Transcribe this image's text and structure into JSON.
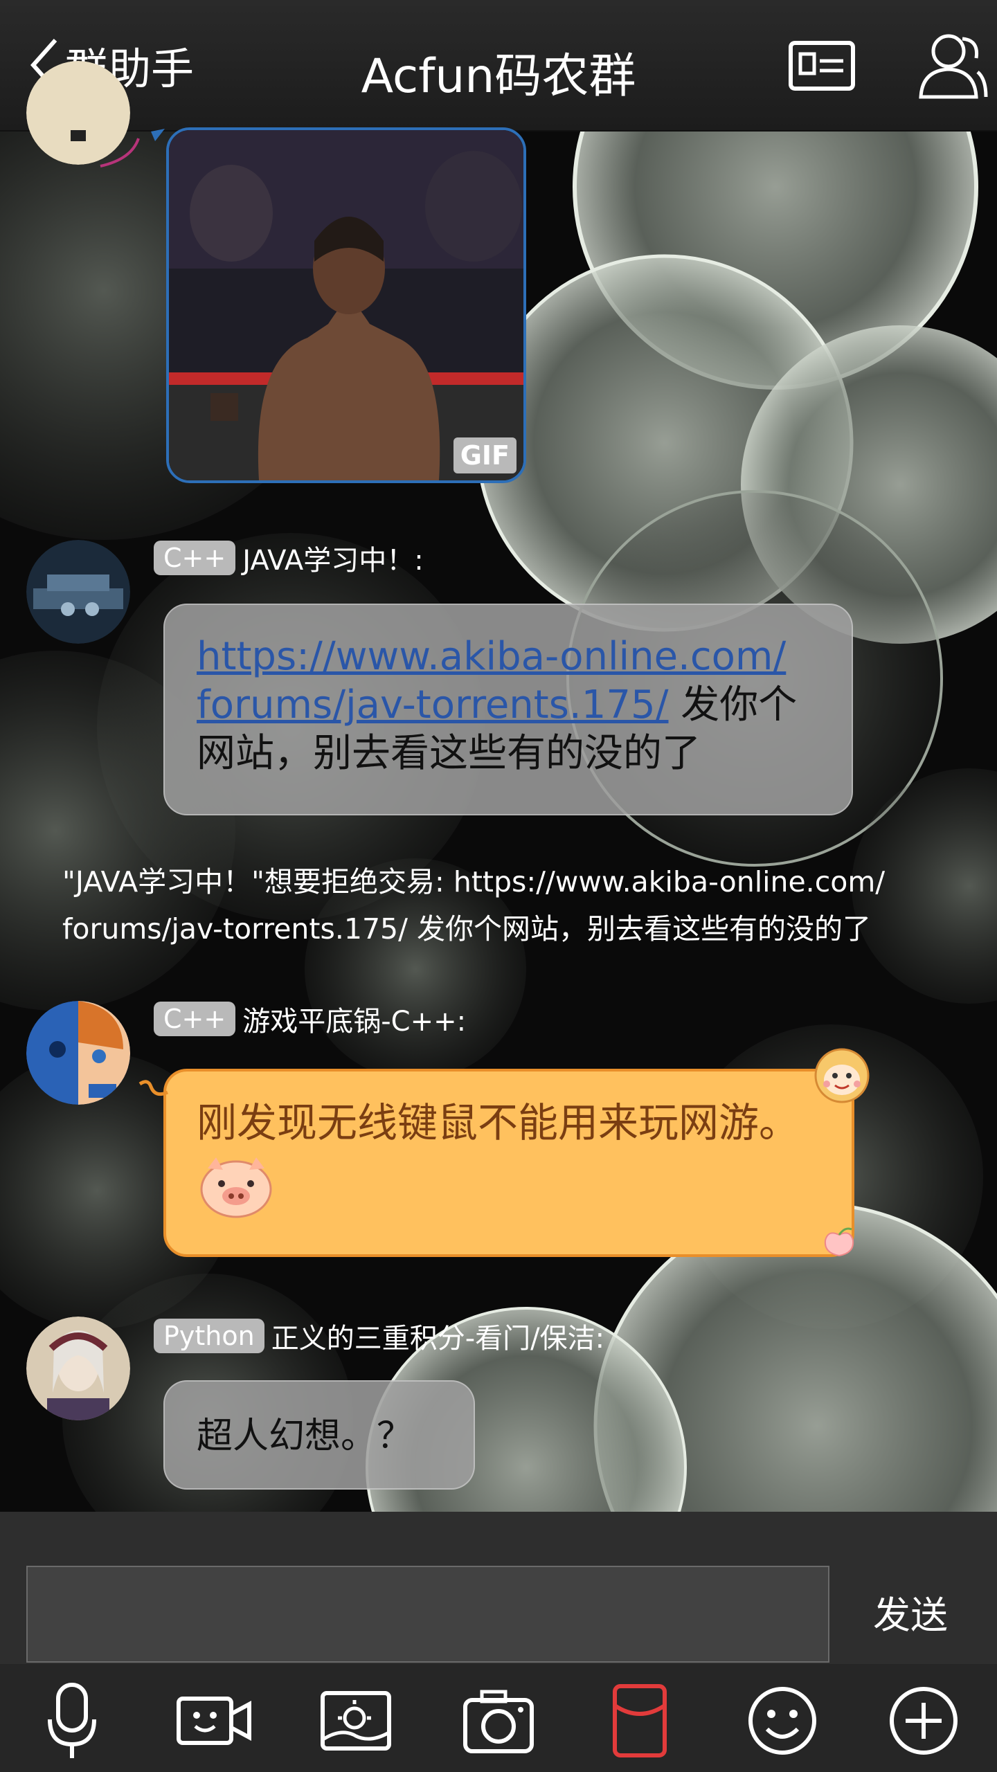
{
  "header": {
    "back_label": "群助手",
    "title": "Acfun码农群"
  },
  "messages": [
    {
      "type": "image",
      "badge": "GIF"
    },
    {
      "type": "text",
      "tag": "C++",
      "sender": "JAVA学习中！:",
      "link": "https://www.akiba-online.com/forums/jav-torrents.175/",
      "link_line1": "https://www.akiba-online.com/",
      "link_line2": "forums/jav-torrents.175/",
      "text_tail": " 发你个",
      "text_line3": "网站，别去看这些有的没的了"
    },
    {
      "type": "system",
      "text": "\"JAVA学习中！\"想要拒绝交易: https://www.akiba-online.com/ forums/jav-torrents.175/ 发你个网站，别去看这些有的没的了"
    },
    {
      "type": "text",
      "tag": "C++",
      "sender": "游戏平底锅-C++:",
      "text": "刚发现无线键鼠不能用来玩网游。",
      "emoji": "pig-face-icon"
    },
    {
      "type": "text",
      "tag": "Python",
      "sender": "正义的三重积分-看门/保洁:",
      "text": "超人幻想。？"
    }
  ],
  "composer": {
    "input_value": "",
    "send_label": "发送"
  },
  "toolbar": {
    "icons": [
      "microphone-icon",
      "video-call-icon",
      "image-gallery-icon",
      "camera-icon",
      "red-packet-icon",
      "emoji-icon",
      "plus-icon"
    ]
  },
  "colors": {
    "header_bg": "#222222",
    "orange_bubble": "#ffc15e",
    "link": "#2a56a8",
    "red_packet": "#e23b3b"
  }
}
